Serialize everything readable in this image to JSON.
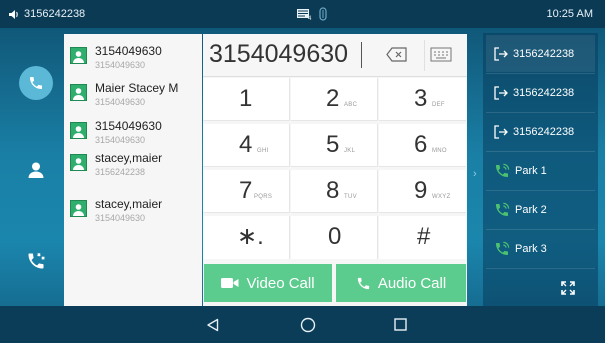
{
  "status": {
    "account": "3156242238",
    "time": "10:25 AM"
  },
  "nav": {
    "items": [
      {
        "name": "dial-phone-icon"
      },
      {
        "name": "contacts-icon"
      },
      {
        "name": "call-history-icon"
      }
    ]
  },
  "recent": [
    {
      "name": "3154049630",
      "number": "3154049630"
    },
    {
      "name": "Maier Stacey M",
      "number": "3154049630"
    },
    {
      "name": "3154049630",
      "number": "3154049630"
    },
    {
      "name": "stacey,maier",
      "number": "3156242238"
    },
    {
      "name": "stacey,maier",
      "number": "3154049630"
    }
  ],
  "dialpad": {
    "input_value": "3154049630",
    "keys": [
      {
        "digit": "1",
        "letters": ""
      },
      {
        "digit": "2",
        "letters": "ABC"
      },
      {
        "digit": "3",
        "letters": "DEF"
      },
      {
        "digit": "4",
        "letters": "GHI"
      },
      {
        "digit": "5",
        "letters": "JKL"
      },
      {
        "digit": "6",
        "letters": "MNO"
      },
      {
        "digit": "7",
        "letters": "PQRS"
      },
      {
        "digit": "8",
        "letters": "TUV"
      },
      {
        "digit": "9",
        "letters": "WXYZ"
      },
      {
        "digit": "∗.",
        "letters": ""
      },
      {
        "digit": "0",
        "letters": ""
      },
      {
        "digit": "#",
        "letters": ""
      }
    ],
    "video_call_label": "Video Call",
    "audio_call_label": "Audio Call"
  },
  "right_panel": {
    "lines": [
      "3156242238",
      "3156242238",
      "3156242238"
    ],
    "parks": [
      "Park 1",
      "Park 2",
      "Park 3"
    ]
  },
  "colors": {
    "accent_green": "#5ccb8e",
    "avatar_green": "#2fae6e",
    "bar_dark": "#0b3a55",
    "nav_active": "#5bb8d6"
  }
}
